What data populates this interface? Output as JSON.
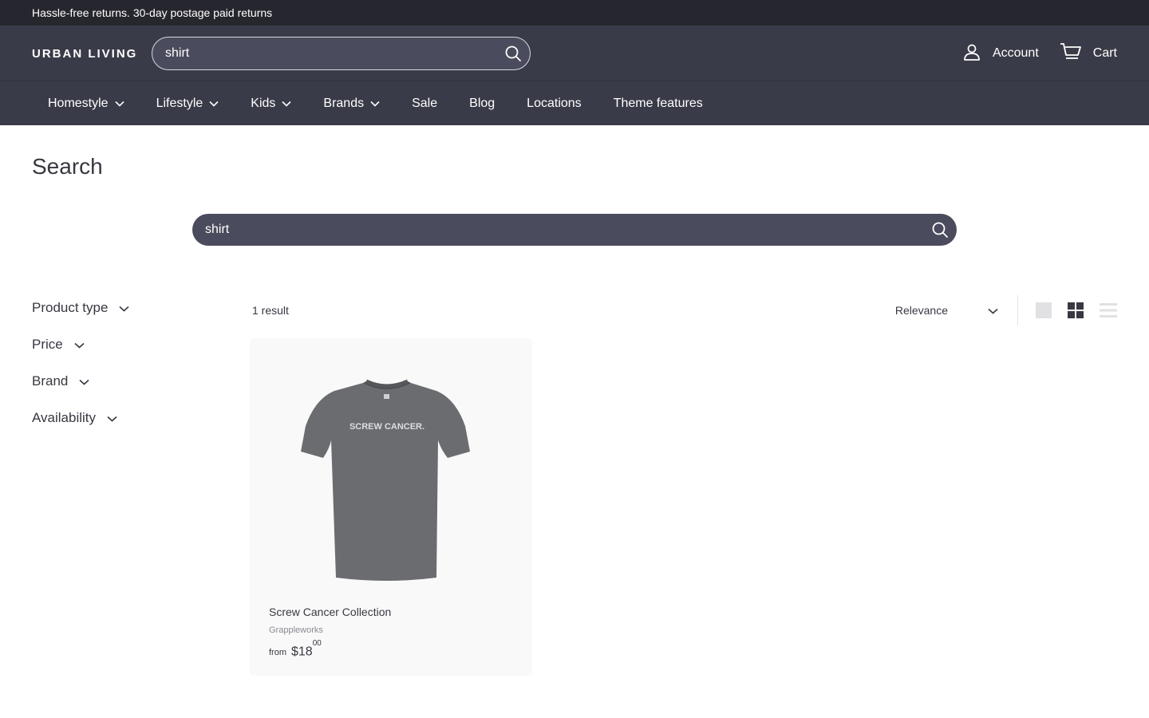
{
  "announcement": "Hassle-free returns. 30-day postage paid returns",
  "header": {
    "logo": "URBAN LIVING",
    "search_value": "shirt",
    "account_label": "Account",
    "cart_label": "Cart"
  },
  "nav": {
    "items": [
      {
        "label": "Homestyle",
        "dropdown": true
      },
      {
        "label": "Lifestyle",
        "dropdown": true
      },
      {
        "label": "Kids",
        "dropdown": true
      },
      {
        "label": "Brands",
        "dropdown": true
      },
      {
        "label": "Sale",
        "dropdown": false
      },
      {
        "label": "Blog",
        "dropdown": false
      },
      {
        "label": "Locations",
        "dropdown": false
      },
      {
        "label": "Theme features",
        "dropdown": false
      }
    ]
  },
  "page": {
    "title": "Search",
    "search_value": "shirt"
  },
  "filters": [
    "Product type",
    "Price",
    "Brand",
    "Availability"
  ],
  "results": {
    "count_label": "1 result",
    "sort_value": "Relevance",
    "views": [
      "large-grid-view-icon",
      "small-grid-view-icon",
      "list-view-icon"
    ],
    "active_view": "small-grid-view-icon"
  },
  "products": [
    {
      "title": "Screw Cancer Collection",
      "vendor": "Grappleworks",
      "price_prefix": "from",
      "price_main": "$18",
      "price_cents": "00",
      "image_text": "SCREW CANCER."
    }
  ],
  "colors": {
    "announcement_bg": "#26262e",
    "header_bg": "#3a3b48",
    "search_bg": "#4a4b5c",
    "text": "#373842",
    "card_bg": "#f9f9f9"
  }
}
